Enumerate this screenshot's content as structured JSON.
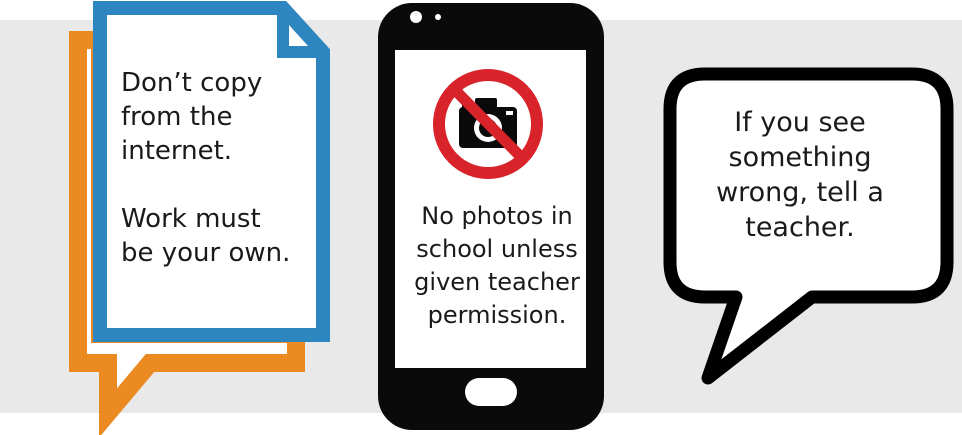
{
  "colors": {
    "background_band": "#e9e9e9",
    "orange_frame": "#ec8a22",
    "blue_frame": "#2e86c1",
    "phone_body": "#0a0a0a",
    "no_sign_red": "#d9232a"
  },
  "icons": {
    "camera": "camera-icon",
    "prohibited": "no-sign-icon"
  },
  "document_card": {
    "line1": "Don’t copy",
    "line2": "from the",
    "line3": "internet.",
    "line4": "Work must",
    "line5": "be your own."
  },
  "phone_card": {
    "line1": "No photos in",
    "line2": "school unless",
    "line3": "given teacher",
    "line4": "permission."
  },
  "speech_bubble": {
    "line1": "If you see",
    "line2": "something",
    "line3": "wrong, tell a",
    "line4": "teacher."
  }
}
